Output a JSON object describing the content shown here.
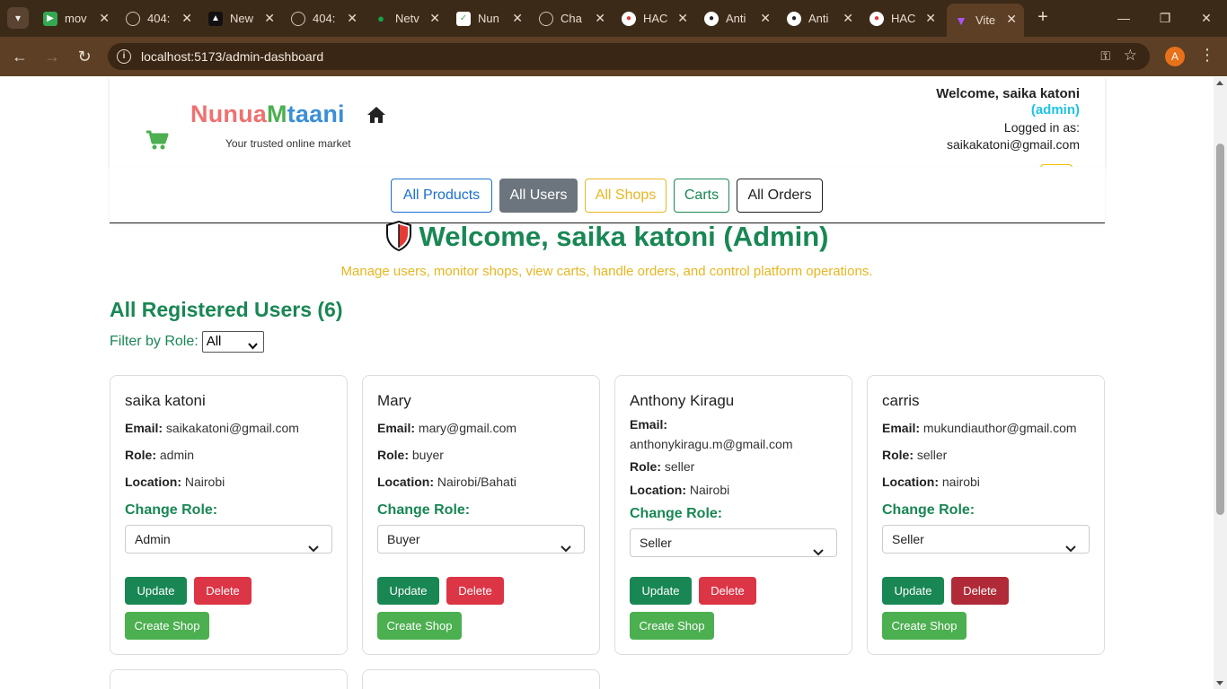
{
  "browser": {
    "tabs": [
      {
        "label": "mov",
        "color": "#34a853"
      },
      {
        "label": "404:",
        "color": "#8a8a8a"
      },
      {
        "label": "New",
        "color": "#111111"
      },
      {
        "label": "404:",
        "color": "#8a8a8a"
      },
      {
        "label": "Netv",
        "color": "#16a34a"
      },
      {
        "label": "Nun",
        "color": "#4caf50"
      },
      {
        "label": "Cha",
        "color": "#6b6b6b"
      },
      {
        "label": "HAC",
        "color": "#e53935"
      },
      {
        "label": "Anti",
        "color": "#222222"
      },
      {
        "label": "Anti",
        "color": "#222222"
      },
      {
        "label": "HAC",
        "color": "#e53935"
      },
      {
        "label": "Vite",
        "color": "#a855f7"
      }
    ],
    "url": "localhost:5173/admin-dashboard",
    "profile_initial": "A"
  },
  "header": {
    "brand_part1": "Nunua",
    "brand_part2": "M",
    "brand_part3": "taani",
    "tagline": "Your trusted online market",
    "welcome": "Welcome, saika katoni",
    "role": "(admin)",
    "logged_in_label": "Logged in as:",
    "email": "saikakatoni@gmail.com"
  },
  "nav": {
    "all_products": "All Products",
    "all_users": "All Users",
    "all_shops": "All Shops",
    "carts": "Carts",
    "all_orders": "All Orders"
  },
  "hero": {
    "title": "Welcome, saika katoni (Admin)",
    "subtitle": "Manage users, monitor shops, view carts, handle orders, and control platform operations."
  },
  "users_section": {
    "title": "All Registered Users (6)",
    "filter_label": "Filter by Role:",
    "filter_value": "All"
  },
  "labels": {
    "email": "Email:",
    "role": "Role:",
    "location": "Location:",
    "change_role": "Change Role:",
    "update": "Update",
    "delete": "Delete",
    "create_shop": "Create Shop"
  },
  "users": [
    {
      "name": "saika katoni",
      "email": "saikakatoni@gmail.com",
      "role": "admin",
      "location": "Nairobi",
      "selected_role": "Admin"
    },
    {
      "name": "Mary",
      "email": "mary@gmail.com",
      "role": "buyer",
      "location": "Nairobi/Bahati",
      "selected_role": "Buyer"
    },
    {
      "name": "Anthony Kiragu",
      "email": "anthonykiragu.m@gmail.com",
      "role": "seller",
      "location": "Nairobi",
      "selected_role": "Seller"
    },
    {
      "name": "carris",
      "email": "mukundiauthor@gmail.com",
      "role": "seller",
      "location": "nairobi",
      "selected_role": "Seller"
    }
  ],
  "colors": {
    "primary_green": "#198754",
    "accent_yellow": "#e8b621",
    "danger": "#dc3545",
    "shop_green": "#4caf50",
    "admin_cyan": "#1ec3e6"
  }
}
